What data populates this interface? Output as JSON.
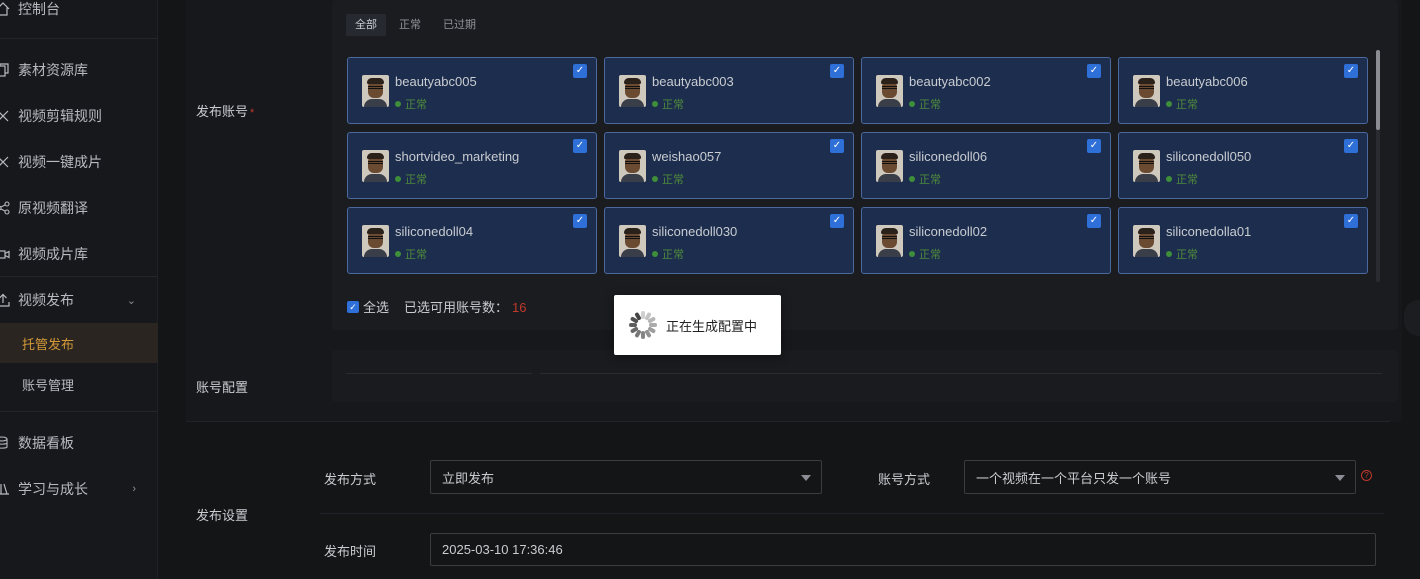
{
  "sidebar": {
    "items": [
      {
        "label": "控制台",
        "icon": "home-icon"
      },
      {
        "label": "素材资源库",
        "icon": "copy-icon"
      },
      {
        "label": "视频剪辑规则",
        "icon": "scissors-icon"
      },
      {
        "label": "视频一键成片",
        "icon": "scissors-icon"
      },
      {
        "label": "原视频翻译",
        "icon": "share-icon"
      },
      {
        "label": "视频成片库",
        "icon": "video-icon"
      },
      {
        "label": "视频发布",
        "icon": "upload-icon"
      },
      {
        "label": "数据看板",
        "icon": "database-icon"
      },
      {
        "label": "学习与成长",
        "icon": "books-icon"
      }
    ],
    "sub_items": [
      {
        "label": "托管发布",
        "active": true
      },
      {
        "label": "账号管理",
        "active": false
      }
    ]
  },
  "publish_accounts": {
    "label": "发布账号",
    "required_mark": "*",
    "tabs": [
      "全部",
      "正常",
      "已过期"
    ],
    "active_tab": "全部",
    "accounts": [
      {
        "name": "beautyabc005",
        "status": "正常",
        "checked": true
      },
      {
        "name": "beautyabc003",
        "status": "正常",
        "checked": true
      },
      {
        "name": "beautyabc002",
        "status": "正常",
        "checked": true
      },
      {
        "name": "beautyabc006",
        "status": "正常",
        "checked": true
      },
      {
        "name": "shortvideo_marketing",
        "status": "正常",
        "checked": true
      },
      {
        "name": "weishao057",
        "status": "正常",
        "checked": true
      },
      {
        "name": "siliconedoll06",
        "status": "正常",
        "checked": true
      },
      {
        "name": "siliconedoll050",
        "status": "正常",
        "checked": true
      },
      {
        "name": "siliconedoll04",
        "status": "正常",
        "checked": true
      },
      {
        "name": "siliconedoll030",
        "status": "正常",
        "checked": true
      },
      {
        "name": "siliconedoll02",
        "status": "正常",
        "checked": true
      },
      {
        "name": "siliconedolla01",
        "status": "正常",
        "checked": true
      }
    ],
    "select_all_label": "全选",
    "available_label": "已选可用账号数：",
    "available_count": "16"
  },
  "account_config": {
    "label": "账号配置"
  },
  "publish_settings": {
    "label": "发布设置",
    "method_label": "发布方式",
    "method_value": "立即发布",
    "account_mode_label": "账号方式",
    "account_mode_value": "一个视频在一个平台只发一个账号",
    "time_label": "发布时间",
    "time_value": "2025-03-10 17:36:46"
  },
  "loading": {
    "text": "正在生成配置中"
  },
  "colors": {
    "accent": "#d49a3a",
    "card_bg": "#1c2d4d",
    "card_border": "#4a6a9e",
    "status_green": "#4f8a3c",
    "count_red": "#c0392b",
    "checkbox_blue": "#2f6fd8"
  }
}
